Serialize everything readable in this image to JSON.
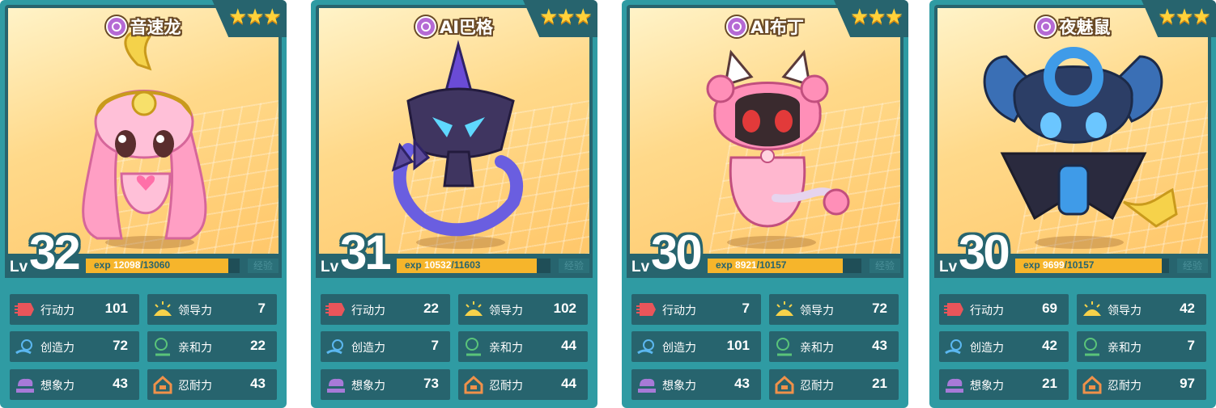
{
  "colors": {
    "card_bg": "#2f9ba3",
    "panel": "#27646e",
    "exp_fill": "#f6b52b",
    "portrait_bg": "#ffd98a"
  },
  "cards": [
    {
      "name": "音速龙",
      "rarity_stars": 3,
      "stars": "★★★",
      "type_icon": "psychic-type-icon",
      "lv_label": "Lv",
      "level": "32",
      "exp_label": "exp",
      "exp_current": "12098",
      "exp_total": "/13060",
      "exp_fraction": 0.926,
      "exp_button": "经验",
      "stats": [
        {
          "icon": "action-icon",
          "label": "行动力",
          "value": "101"
        },
        {
          "icon": "leadership-icon",
          "label": "领导力",
          "value": "7"
        },
        {
          "icon": "creativity-icon",
          "label": "创造力",
          "value": "72"
        },
        {
          "icon": "affinity-icon",
          "label": "亲和力",
          "value": "22"
        },
        {
          "icon": "imagination-icon",
          "label": "想象力",
          "value": "43"
        },
        {
          "icon": "endurance-icon",
          "label": "忍耐力",
          "value": "43"
        }
      ]
    },
    {
      "name": "AI巴格",
      "rarity_stars": 3,
      "stars": "★★★",
      "type_icon": "psychic-type-icon",
      "lv_label": "Lv",
      "level": "31",
      "exp_label": "exp",
      "exp_current": "10532",
      "exp_total": "/11603",
      "exp_fraction": 0.908,
      "exp_button": "经验",
      "stats": [
        {
          "icon": "action-icon",
          "label": "行动力",
          "value": "22"
        },
        {
          "icon": "leadership-icon",
          "label": "领导力",
          "value": "102"
        },
        {
          "icon": "creativity-icon",
          "label": "创造力",
          "value": "7"
        },
        {
          "icon": "affinity-icon",
          "label": "亲和力",
          "value": "44"
        },
        {
          "icon": "imagination-icon",
          "label": "想象力",
          "value": "73"
        },
        {
          "icon": "endurance-icon",
          "label": "忍耐力",
          "value": "44"
        }
      ]
    },
    {
      "name": "AI布丁",
      "rarity_stars": 3,
      "stars": "★★★",
      "type_icon": "psychic-type-icon",
      "lv_label": "Lv",
      "level": "30",
      "exp_label": "exp",
      "exp_current": "8921",
      "exp_total": "/10157",
      "exp_fraction": 0.878,
      "exp_button": "经验",
      "stats": [
        {
          "icon": "action-icon",
          "label": "行动力",
          "value": "7"
        },
        {
          "icon": "leadership-icon",
          "label": "领导力",
          "value": "72"
        },
        {
          "icon": "creativity-icon",
          "label": "创造力",
          "value": "101"
        },
        {
          "icon": "affinity-icon",
          "label": "亲和力",
          "value": "43"
        },
        {
          "icon": "imagination-icon",
          "label": "想象力",
          "value": "43"
        },
        {
          "icon": "endurance-icon",
          "label": "忍耐力",
          "value": "21"
        }
      ]
    },
    {
      "name": "夜魅鼠",
      "rarity_stars": 3,
      "stars": "★★★",
      "type_icon": "psychic-type-icon",
      "lv_label": "Lv",
      "level": "30",
      "exp_label": "exp",
      "exp_current": "9699",
      "exp_total": "/10157",
      "exp_fraction": 0.955,
      "exp_button": "经验",
      "stats": [
        {
          "icon": "action-icon",
          "label": "行动力",
          "value": "69"
        },
        {
          "icon": "leadership-icon",
          "label": "领导力",
          "value": "42"
        },
        {
          "icon": "creativity-icon",
          "label": "创造力",
          "value": "42"
        },
        {
          "icon": "affinity-icon",
          "label": "亲和力",
          "value": "7"
        },
        {
          "icon": "imagination-icon",
          "label": "想象力",
          "value": "21"
        },
        {
          "icon": "endurance-icon",
          "label": "忍耐力",
          "value": "97"
        }
      ]
    }
  ]
}
